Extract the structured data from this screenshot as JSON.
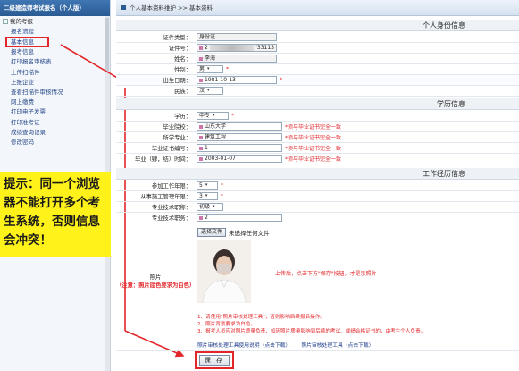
{
  "sidebar": {
    "title": "二级建造师考试报名（个人版）",
    "section": "我的考报",
    "items": [
      {
        "label": "报名流程"
      },
      {
        "label": "基本信息"
      },
      {
        "label": "报考信息"
      },
      {
        "label": "打印报名审核表"
      },
      {
        "label": "上传扫描件"
      },
      {
        "label": "上报企业"
      },
      {
        "label": "查看扫描件审核情况"
      },
      {
        "label": "网上缴费"
      },
      {
        "label": "打印电子发票"
      },
      {
        "label": "打印准考证"
      },
      {
        "label": "成绩查询记录"
      },
      {
        "label": "修改密码"
      }
    ],
    "tip": "提示：同一个浏览器不能打开多个考生系统，否则信息会冲突！"
  },
  "header": {
    "breadcrumb": "个人基本资料维护 >> 基本资料"
  },
  "sections": {
    "identity": "个人身份信息",
    "education": "学历信息",
    "work": "工作经历信息"
  },
  "identity": {
    "id_type_label": "证件类型：",
    "id_type_value": "身份证",
    "id_no_label": "证件号：",
    "id_no_prefix": "2",
    "id_no_suffix": "'33113",
    "name_label": "姓名：",
    "name_value": "李海",
    "gender_label": "性别：",
    "gender_value": "男",
    "birth_label": "出生日期：",
    "birth_value": "1981-10-13",
    "ethnic_label": "民族：",
    "ethnic_value": "汉"
  },
  "education": {
    "degree_label": "学历：",
    "degree_value": "中专",
    "school_label": "毕业院校：",
    "school_value": "山东大学",
    "school_hint": "*须与毕业证书完全一致",
    "major_label": "所学专业：",
    "major_value": "建筑工程",
    "major_hint": "*须与毕业证书完全一致",
    "cert_label": "毕业证书编号：",
    "cert_value": "1",
    "cert_hint": "*须与毕业证书完全一致",
    "grad_label": "毕业（肄，结）时间：",
    "grad_value": "2003-01-07",
    "grad_hint": "*须与毕业证书完全一致"
  },
  "work": {
    "years_label": "参加工作年限：",
    "years_value": "5",
    "mgmt_label": "从事施工管理年限：",
    "mgmt_value": "3",
    "title_label": "专业技术职称：",
    "title_value": "初级",
    "level_label": "专业技术职务：",
    "level_value": "2"
  },
  "photo": {
    "label": "照片",
    "note": "（注意：照片底色要求为白色）",
    "choose_button": "选择文件",
    "no_file": "未选择任何文件",
    "side_tip": "上传后，点击下方\"保存\"按钮，才是示照片",
    "notes": [
      "1、请使用\"照片审核处理工具\"，否则影响后续报名操作。",
      "2、照片背景要求为白色。",
      "3、报考人员应对照片质量负责，如因照片质量影响到后续的考试、成绩合格证书的，由考生个人负责。"
    ],
    "tool_link": "照片审核处理工具使用说明（点击下载）",
    "tool_link2": "照片审核处理工具（点击下载）"
  },
  "save_label": "保 存"
}
